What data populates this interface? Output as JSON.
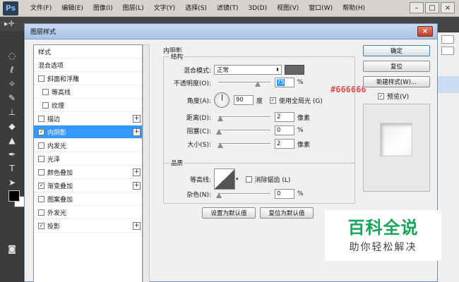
{
  "app": {
    "logo": "Ps",
    "menus": [
      "文件(F)",
      "编辑(E)",
      "图像(I)",
      "图层(L)",
      "文字(Y)",
      "选择(S)",
      "滤镜(T)",
      "3D(D)",
      "视图(V)",
      "窗口(W)",
      "帮助(H)"
    ],
    "window_controls": [
      "–",
      "□",
      "×"
    ]
  },
  "dialog": {
    "title": "图层样式",
    "close_label": "×",
    "style_list": [
      {
        "label": "样式",
        "checkbox": false,
        "checked": false,
        "plus": false,
        "indent": false,
        "selected": false
      },
      {
        "label": "混合选项",
        "checkbox": false,
        "checked": false,
        "plus": false,
        "indent": false,
        "selected": false
      },
      {
        "label": "斜面和浮雕",
        "checkbox": true,
        "checked": false,
        "plus": false,
        "indent": false,
        "selected": false
      },
      {
        "label": "等高线",
        "checkbox": true,
        "checked": false,
        "plus": false,
        "indent": true,
        "selected": false
      },
      {
        "label": "纹理",
        "checkbox": true,
        "checked": false,
        "plus": false,
        "indent": true,
        "selected": false
      },
      {
        "label": "描边",
        "checkbox": true,
        "checked": false,
        "plus": true,
        "indent": false,
        "selected": false
      },
      {
        "label": "内阴影",
        "checkbox": true,
        "checked": true,
        "plus": true,
        "indent": false,
        "selected": true
      },
      {
        "label": "内发光",
        "checkbox": true,
        "checked": false,
        "plus": false,
        "indent": false,
        "selected": false
      },
      {
        "label": "光泽",
        "checkbox": true,
        "checked": false,
        "plus": false,
        "indent": false,
        "selected": false
      },
      {
        "label": "颜色叠加",
        "checkbox": true,
        "checked": false,
        "plus": true,
        "indent": false,
        "selected": false
      },
      {
        "label": "渐变叠加",
        "checkbox": true,
        "checked": true,
        "plus": true,
        "indent": false,
        "selected": false
      },
      {
        "label": "图案叠加",
        "checkbox": true,
        "checked": false,
        "plus": false,
        "indent": false,
        "selected": false
      },
      {
        "label": "外发光",
        "checkbox": true,
        "checked": false,
        "plus": false,
        "indent": false,
        "selected": false
      },
      {
        "label": "投影",
        "checkbox": true,
        "checked": true,
        "plus": true,
        "indent": false,
        "selected": false
      }
    ],
    "inner_shadow": {
      "section_title": "内阴影",
      "structure": {
        "group_title": "结构",
        "blend_mode_label": "混合模式:",
        "blend_mode_value": "正常",
        "shadow_color": "#666666",
        "color_note": "#666666",
        "opacity_label": "不透明度(O):",
        "opacity_value": "75",
        "opacity_unit": "%",
        "angle_label": "角度(A):",
        "angle_value": "90",
        "angle_unit": "度",
        "global_light_label": "使用全局光 (G)",
        "global_light_checked": true,
        "distance_label": "距离(D):",
        "distance_value": "2",
        "distance_unit": "像素",
        "choke_label": "阻塞(C):",
        "choke_value": "0",
        "choke_unit": "%",
        "size_label": "大小(S):",
        "size_value": "2",
        "size_unit": "像素"
      },
      "quality": {
        "group_title": "品质",
        "contour_label": "等高线:",
        "antialias_label": "消除锯齿 (L)",
        "antialias_checked": false,
        "noise_label": "杂色(N):",
        "noise_value": "0",
        "noise_unit": "%"
      },
      "make_default_label": "设置为默认值",
      "reset_default_label": "复位为默认值"
    },
    "buttons": {
      "ok": "确定",
      "reset": "复位",
      "new_style": "新建样式(W)...",
      "preview_label": "预览(V)",
      "preview_checked": true
    }
  },
  "watermark": {
    "title": "百科全说",
    "subtitle": "助你轻松解决"
  }
}
